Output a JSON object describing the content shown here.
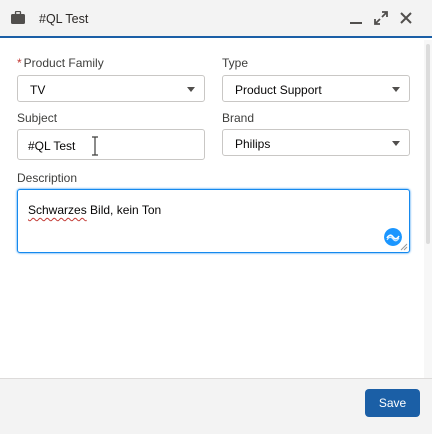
{
  "header": {
    "title": "#QL Test",
    "icon": "briefcase-icon"
  },
  "form": {
    "product_family": {
      "label": "Product Family",
      "required_mark": "*",
      "value": "TV"
    },
    "type": {
      "label": "Type",
      "value": "Product Support"
    },
    "subject": {
      "label": "Subject",
      "value": "#QL Test"
    },
    "brand": {
      "label": "Brand",
      "value": "Philips"
    },
    "description": {
      "label": "Description",
      "misspelled_word": "Schwarzes",
      "rest": " Bild, kein Ton"
    }
  },
  "footer": {
    "save_label": "Save"
  },
  "colors": {
    "accent": "#1b5fa6",
    "focus": "#1589ee",
    "assistant": "#1b96ff"
  }
}
